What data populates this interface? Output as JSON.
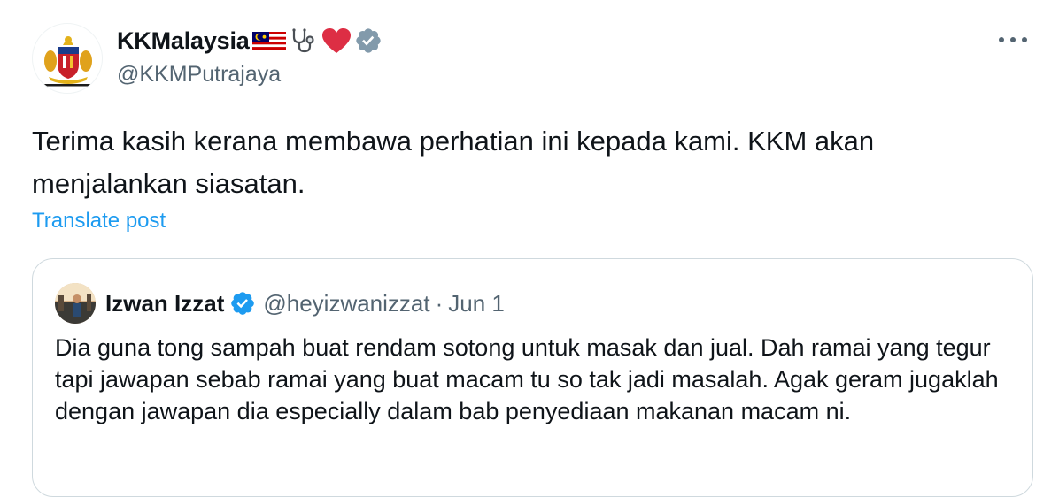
{
  "author": {
    "display_name": "KKMalaysia",
    "emoji_icons": [
      "malaysia-flag-icon",
      "stethoscope-icon",
      "red-heart-icon"
    ],
    "verified_badge_color": "#829aab",
    "handle": "@KKMPutrajaya"
  },
  "tweet": {
    "text": "Terima kasih kerana membawa perhatian ini kepada kami. KKM akan menjalankan siasatan.",
    "translate_label": "Translate post"
  },
  "quoted_tweet": {
    "display_name": "Izwan Izzat",
    "verified_badge_color": "#1d9bf0",
    "handle": "@heyizwanizzat",
    "separator": "·",
    "date": "Jun 1",
    "text": "Dia guna tong sampah buat rendam sotong untuk masak dan jual. Dah ramai yang tegur tapi jawapan sebab ramai yang buat macam tu so tak jadi masalah. Agak geram jugaklah dengan jawapan dia especially dalam bab penyediaan makanan macam ni."
  },
  "colors": {
    "link": "#1d9bf0",
    "secondary_text": "#536471",
    "primary_text": "#0f1419",
    "border": "#cfd9de"
  }
}
